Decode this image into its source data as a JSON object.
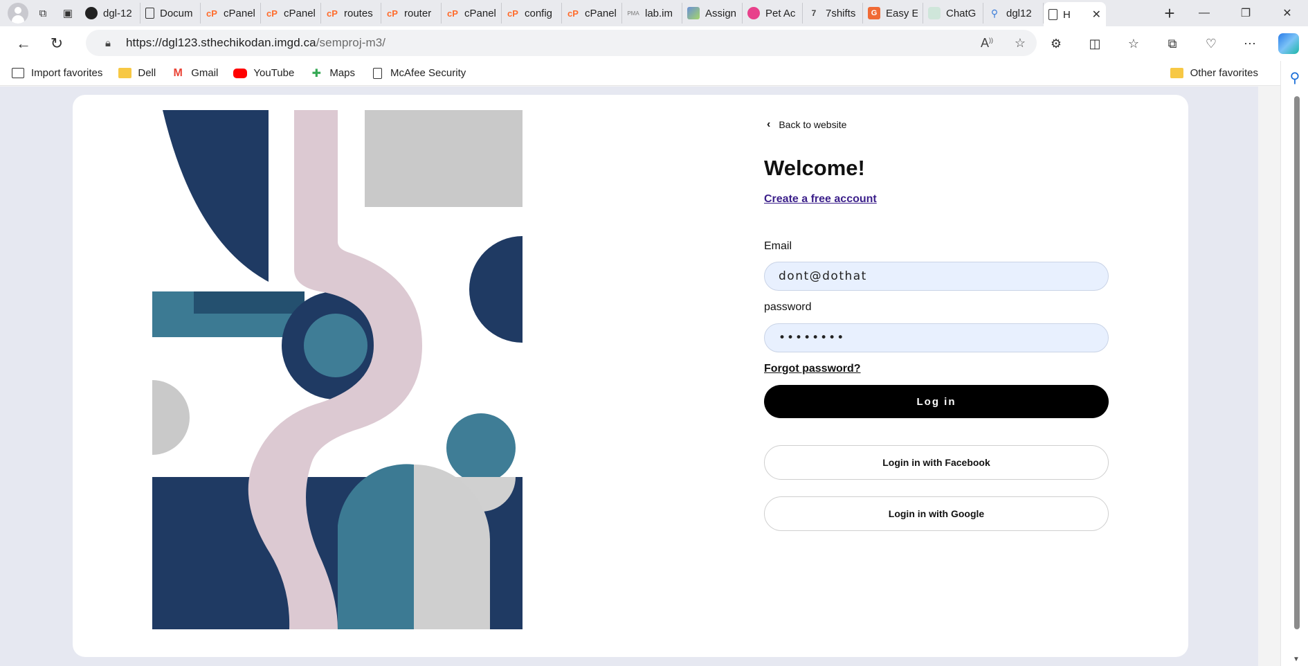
{
  "browser": {
    "tabs": [
      {
        "label": "dgl-12",
        "icon": "github-icon"
      },
      {
        "label": "Docum",
        "icon": "document-icon"
      },
      {
        "label": "cPanel",
        "icon": "cpanel-icon"
      },
      {
        "label": "cPanel",
        "icon": "cpanel-icon"
      },
      {
        "label": "routes",
        "icon": "cpanel-icon"
      },
      {
        "label": "router",
        "icon": "cpanel-icon"
      },
      {
        "label": "cPanel",
        "icon": "cpanel-icon"
      },
      {
        "label": "config",
        "icon": "cpanel-icon"
      },
      {
        "label": "cPanel",
        "icon": "cpanel-icon"
      },
      {
        "label": "lab.im",
        "icon": "phpmyadmin-icon"
      },
      {
        "label": "Assign",
        "icon": "chart-icon"
      },
      {
        "label": "Pet Ac",
        "icon": "dribbble-icon"
      },
      {
        "label": "7shifts",
        "icon": "sevenshifts-icon"
      },
      {
        "label": "Easy E",
        "icon": "easy-icon"
      },
      {
        "label": "ChatG",
        "icon": "chatgpt-icon"
      },
      {
        "label": "dgl12",
        "icon": "search-icon"
      }
    ],
    "active_tab": {
      "label": "H",
      "icon": "document-icon"
    },
    "url_host": "https://dgl123.sthechikodan.imgd.ca",
    "url_path": "/semproj-m3/",
    "favorites": [
      {
        "label": "Import favorites",
        "icon": "import-icon"
      },
      {
        "label": "Dell",
        "icon": "folder-icon"
      },
      {
        "label": "Gmail",
        "icon": "gmail-icon"
      },
      {
        "label": "YouTube",
        "icon": "youtube-icon"
      },
      {
        "label": "Maps",
        "icon": "maps-icon"
      },
      {
        "label": "McAfee Security",
        "icon": "document-icon"
      }
    ],
    "other_favorites": "Other favorites"
  },
  "page": {
    "back_link": "Back to website",
    "heading": "Welcome!",
    "create_account": "Create a free account",
    "email_label": "Email",
    "email_value": "dont@dothat",
    "password_label": "password",
    "password_value": "••••••••",
    "forgot": "Forgot password?",
    "login_button": "Log in",
    "facebook_button": "Login in with Facebook",
    "google_button": "Login in with Google"
  },
  "colors": {
    "navy": "#1e3a63",
    "teal": "#3f7d96",
    "pink": "#dcc9d2",
    "grey": "#c8c8c8",
    "page_bg": "#e6e8f1",
    "field_bg": "#e8f0fe",
    "link_purple": "#3b1f8a"
  }
}
